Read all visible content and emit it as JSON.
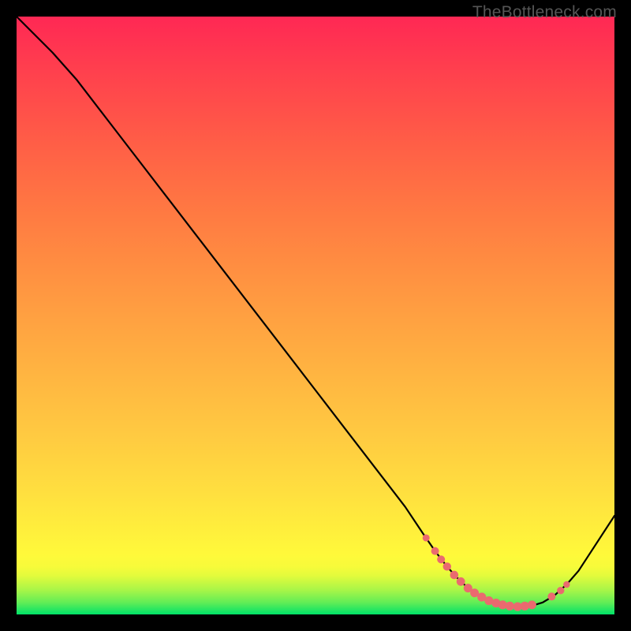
{
  "watermark": "TheBottleneck.com",
  "chart_data": {
    "type": "line",
    "title": "",
    "xlabel": "",
    "ylabel": "",
    "xlim": [
      0,
      100
    ],
    "ylim": [
      0,
      100
    ],
    "series": [
      {
        "name": "bottleneck-curve",
        "x": [
          0,
          6,
          10,
          15,
          20,
          25,
          30,
          35,
          40,
          45,
          50,
          55,
          60,
          65,
          68,
          70,
          72,
          74,
          76,
          78,
          80,
          82,
          84,
          86,
          88,
          90,
          92,
          94,
          100
        ],
        "y": [
          100,
          94,
          89.5,
          83,
          76.5,
          70,
          63.5,
          57,
          50.5,
          44,
          37.5,
          31,
          24.5,
          18,
          13.5,
          10.6,
          8.0,
          5.8,
          4.0,
          2.7,
          1.9,
          1.4,
          1.3,
          1.4,
          2.0,
          3.2,
          5.0,
          7.3,
          16.5
        ]
      }
    ],
    "markers": {
      "name": "highlight-points",
      "color": "#ea6a6f",
      "points": [
        {
          "x": 68.5,
          "y": 12.8,
          "r": 4.5
        },
        {
          "x": 70.0,
          "y": 10.6,
          "r": 5.0
        },
        {
          "x": 71.0,
          "y": 9.2,
          "r": 5.0
        },
        {
          "x": 72.0,
          "y": 8.0,
          "r": 5.2
        },
        {
          "x": 73.2,
          "y": 6.6,
          "r": 5.3
        },
        {
          "x": 74.3,
          "y": 5.5,
          "r": 5.4
        },
        {
          "x": 75.5,
          "y": 4.4,
          "r": 5.5
        },
        {
          "x": 76.6,
          "y": 3.6,
          "r": 5.5
        },
        {
          "x": 77.8,
          "y": 2.9,
          "r": 5.6
        },
        {
          "x": 79.0,
          "y": 2.3,
          "r": 5.6
        },
        {
          "x": 80.2,
          "y": 1.9,
          "r": 5.6
        },
        {
          "x": 81.3,
          "y": 1.6,
          "r": 5.6
        },
        {
          "x": 82.5,
          "y": 1.4,
          "r": 5.6
        },
        {
          "x": 83.8,
          "y": 1.3,
          "r": 5.6
        },
        {
          "x": 85.0,
          "y": 1.4,
          "r": 5.6
        },
        {
          "x": 86.2,
          "y": 1.6,
          "r": 5.5
        },
        {
          "x": 89.5,
          "y": 3.0,
          "r": 5.0
        },
        {
          "x": 91.0,
          "y": 4.0,
          "r": 4.7
        },
        {
          "x": 92.0,
          "y": 5.0,
          "r": 4.2
        }
      ]
    }
  }
}
